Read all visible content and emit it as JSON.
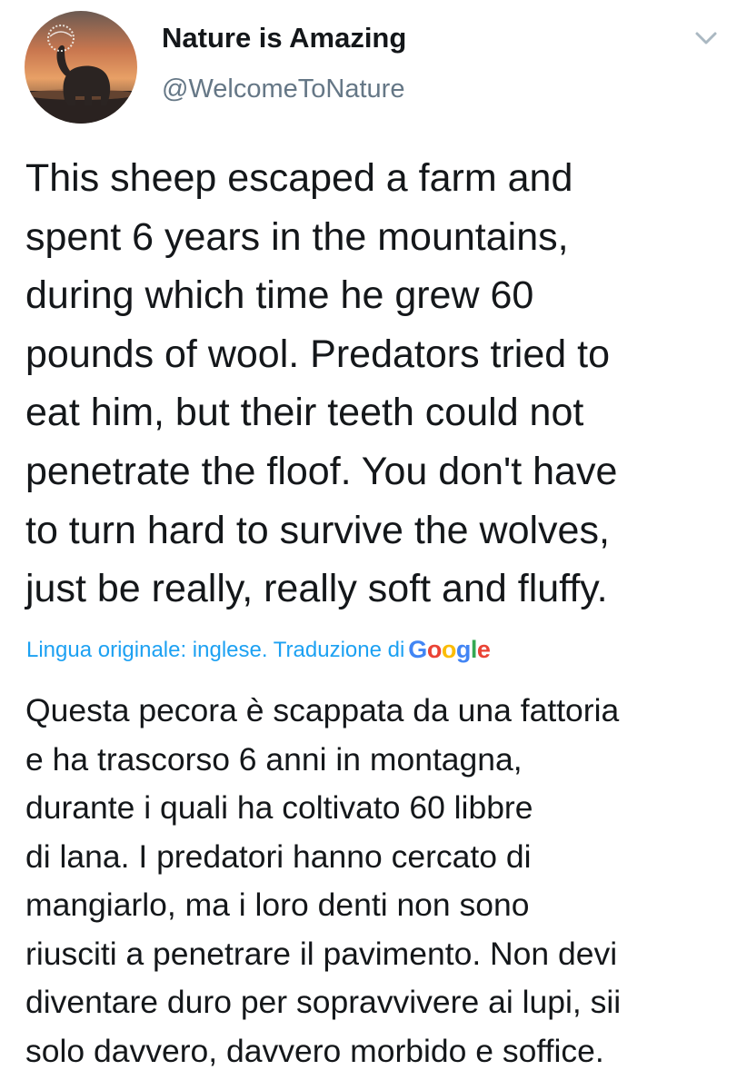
{
  "author": {
    "display_name": "Nature is Amazing",
    "handle": "@WelcomeToNature",
    "avatar_icon": "elephant-sunset-avatar"
  },
  "header": {
    "menu_icon": "chevron-down-icon"
  },
  "tweet": {
    "lines": [
      "This sheep escaped a farm and",
      "spent 6 years in the mountains,",
      "during which time he grew 60",
      "pounds of wool. Predators tried to",
      "eat him, but their teeth could not",
      "penetrate the floof. You don't have",
      "to turn hard to survive the wolves,",
      "just be really, really soft and fluffy."
    ]
  },
  "translation": {
    "note": "Lingua originale: inglese. Traduzione di",
    "provider": "Google",
    "lines": [
      "Questa pecora è scappata da una fattoria",
      "e ha trascorso 6 anni in montagna,",
      "durante i quali ha coltivato 60 libbre",
      "di lana. I predatori hanno cercato di",
      "mangiarlo, ma i loro denti non sono",
      "riusciti a penetrare il pavimento. Non devi",
      "diventare duro per sopravvivere ai lupi, sii",
      "solo davvero, davvero morbido e soffice."
    ]
  },
  "colors": {
    "text": "#14171a",
    "secondary": "#657786",
    "link": "#1da1f2",
    "background": "#ffffff"
  }
}
